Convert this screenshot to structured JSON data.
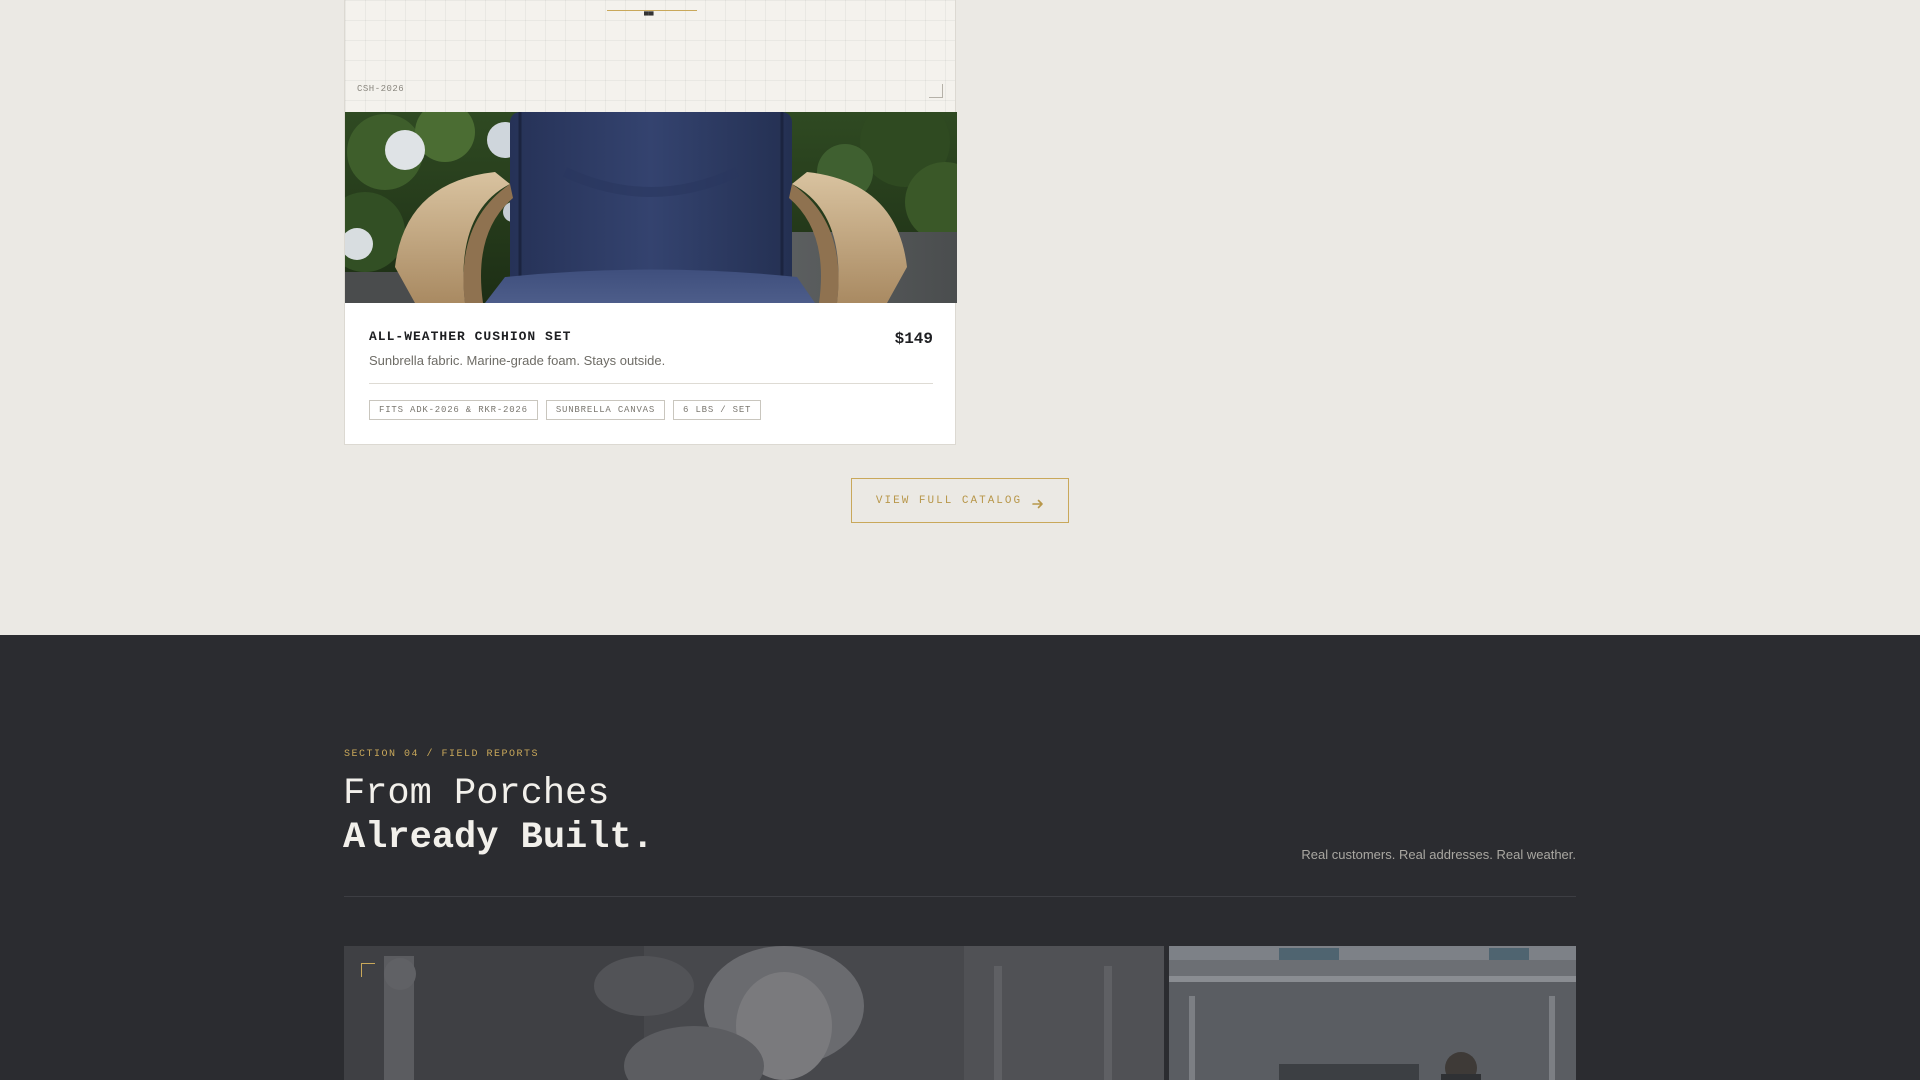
{
  "product_card": {
    "blueprint_code": "CSH-2026",
    "blueprint_mark": "▀▀",
    "title": "ALL-WEATHER CUSHION SET",
    "price": "$149",
    "description": "Sunbrella fabric. Marine-grade foam. Stays outside.",
    "tags": [
      "FITS ADK-2026 & RKR-2026",
      "SUNBRELLA CANVAS",
      "6 LBS / SET"
    ]
  },
  "catalog_button": {
    "label": "VIEW FULL CATALOG",
    "icon": "arrow-right-icon"
  },
  "field_reports": {
    "eyebrow": "SECTION 04 / FIELD REPORTS",
    "title_line_1": "From Porches",
    "title_line_2": "Already Built.",
    "tagline": "Real customers. Real addresses. Real weather."
  },
  "colors": {
    "accent_gold": "#c9a85a",
    "dark_bg": "#2b2c30",
    "light_bg": "#ebe9e4",
    "cushion_navy": "#2e3b63"
  }
}
